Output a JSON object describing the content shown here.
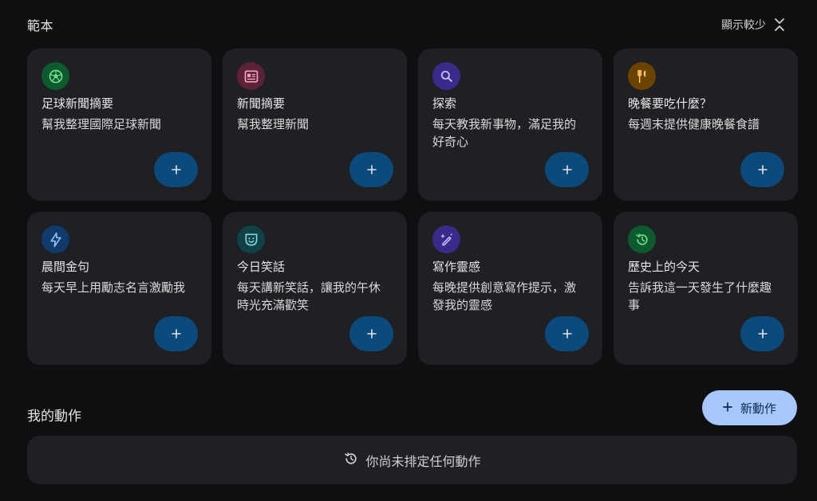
{
  "templates": {
    "section_title": "範本",
    "toggle_label": "顯示較少",
    "cards": [
      {
        "name": "soccer",
        "icon": "soccer-ball-icon",
        "icon_bg": "#0d5a2e",
        "icon_color": "#6fdc8c",
        "title": "足球新聞摘要",
        "description": "幫我整理國際足球新聞"
      },
      {
        "name": "news",
        "icon": "newspaper-icon",
        "icon_bg": "#5e2238",
        "icon_color": "#f2a5bd",
        "title": "新聞摘要",
        "description": "幫我整理新聞"
      },
      {
        "name": "explore",
        "icon": "search-icon",
        "icon_bg": "#3c2a8a",
        "icon_color": "#c9bcff",
        "title": "探索",
        "description": "每天教我新事物，滿足我的好奇心"
      },
      {
        "name": "dinner",
        "icon": "fork-knife-icon",
        "icon_bg": "#6a4300",
        "icon_color": "#ffc46b",
        "title": "晚餐要吃什麼？",
        "description": "每週末提供健康晚餐食譜"
      },
      {
        "name": "morning-quote",
        "icon": "lightning-icon",
        "icon_bg": "#103a6b",
        "icon_color": "#8ec2ff",
        "title": "晨間金句",
        "description": "每天早上用勵志名言激勵我"
      },
      {
        "name": "joke",
        "icon": "smiley-mask-icon",
        "icon_bg": "#0f4147",
        "icon_color": "#7fd8e0",
        "title": "今日笑話",
        "description": "每天講新笑話，讓我的午休時光充滿歡笑"
      },
      {
        "name": "writing",
        "icon": "magic-pen-icon",
        "icon_bg": "#3c2a8a",
        "icon_color": "#c9bcff",
        "title": "寫作靈感",
        "description": "每晚提供創意寫作提示，激發我的靈感"
      },
      {
        "name": "history",
        "icon": "history-icon",
        "icon_bg": "#0d5a2e",
        "icon_color": "#6fdc8c",
        "title": "歷史上的今天",
        "description": "告訴我這一天發生了什麼趣事"
      }
    ],
    "add_button_glyph": "+"
  },
  "my_actions": {
    "title": "我的動作",
    "new_button_label": "新動作",
    "empty_message": "你尚未排定任何動作"
  }
}
